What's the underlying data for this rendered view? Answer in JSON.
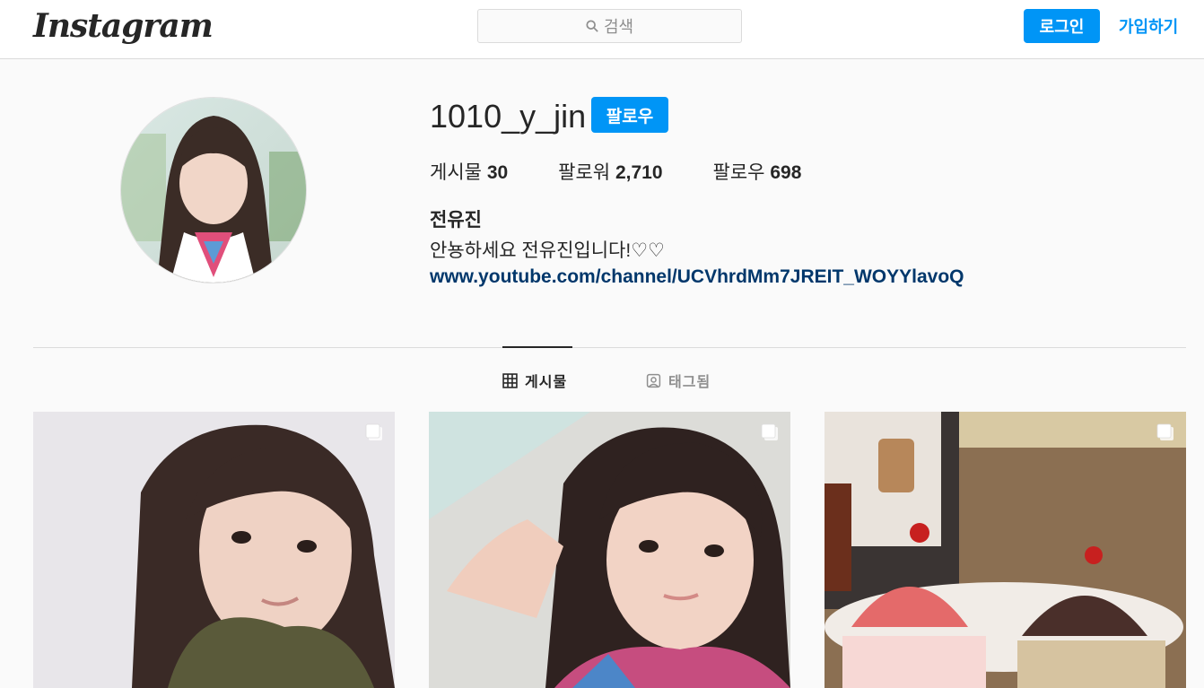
{
  "header": {
    "logo_text": "Instagram",
    "search_placeholder": "검색",
    "login_label": "로그인",
    "signup_label": "가입하기"
  },
  "profile": {
    "username": "1010_y_jin",
    "follow_label": "팔로우",
    "stats": [
      {
        "label": "게시물",
        "value": "30"
      },
      {
        "label": "팔로워",
        "value": "2,710"
      },
      {
        "label": "팔로우",
        "value": "698"
      }
    ],
    "full_name": "전유진",
    "bio": "안뇽하세요 전유진입니다!♡♡",
    "link": "www.youtube.com/channel/UCVhrdMm7JREIT_WOYYlavoQ"
  },
  "tabs": [
    {
      "label": "게시물",
      "icon": "grid-icon",
      "active": true
    },
    {
      "label": "태그됨",
      "icon": "tagged-icon",
      "active": false
    }
  ],
  "colors": {
    "accent": "#0095f6",
    "link": "#00376b",
    "border": "#dbdbdb",
    "background": "#fafafa"
  },
  "posts": [
    {
      "icon": "multiple-photos-icon"
    },
    {
      "icon": "multiple-photos-icon"
    },
    {
      "icon": "multiple-photos-icon"
    }
  ]
}
